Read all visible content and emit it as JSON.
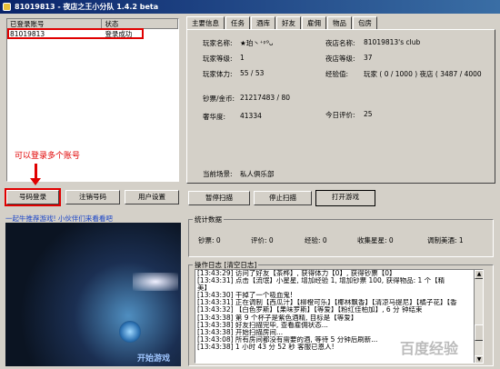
{
  "window": {
    "title": "81019813 - 夜店之王小分队 1.4.2 beta"
  },
  "accounts": {
    "col_account": "已登录账号",
    "col_status": "状态",
    "rows": [
      {
        "account": "81019813",
        "status": "登录成功"
      }
    ]
  },
  "annotation": "可以登录多个账号",
  "buttons": {
    "login": "号码登录",
    "logout": "注销号码",
    "settings": "用户设置",
    "pause_scan": "暂停扫描",
    "stop_scan": "停止扫描",
    "open_game": "打开游戏"
  },
  "promo": {
    "link": "一起牛推荐游戏! 小伙伴们来看看吧",
    "game_text": "开始游戏"
  },
  "tabs": [
    "主要信息",
    "任务",
    "酒库",
    "好友",
    "雇佣",
    "物品",
    "包房"
  ],
  "info": {
    "player_name_label": "玩家名称:",
    "player_name_value": "★珀丶⁺ᵖ⁹ᴗ",
    "club_name_label": "夜店名称:",
    "club_name_value": "81019813's club",
    "player_level_label": "玩家等级:",
    "player_level_value": "1",
    "club_level_label": "夜店等级:",
    "club_level_value": "37",
    "stamina_label": "玩家体力:",
    "stamina_value": "55 / 53",
    "exp_label": "经验值:",
    "exp_value": "玩家 ( 0 / 1000 )   夜店 ( 3487 / 4000",
    "money_label": "钞票/金币:",
    "money_value": "21217483 / 80",
    "luxury_label": "奢华度:",
    "luxury_value": "41334",
    "today_label": "今日评价:",
    "today_value": "25",
    "scene_label": "当前场景:",
    "scene_value": "私人俱乐部"
  },
  "stats": {
    "title": "统计数据",
    "money": "钞票: 0",
    "rating": "评价: 0",
    "exp": "经验: 0",
    "stars": "收集星星: 0",
    "mix": "调制美酒: 1"
  },
  "log": {
    "title": "操作日志",
    "clear": "清空日志",
    "lines": [
      "[13:43:29]  访问了好友【茶桦】, 获得体力【0】, 获得钞票【0】",
      "[13:43:31]  点击【流氓】小星星, 增加经验 1, 增加钞票 100, 获得物品: 1 个【精",
      "              美】",
      "[13:43:30]  干掉了一个吸血鬼!",
      "[13:43:31]  正在调制【西瓜汁】【柳橙可乐】【椰林飘香】【清凉马提尼】【橘子花】【香",
      "[13:43:32]  【白色罗斯】【果味罗斯】【等爱】【粉红佳柏加】, 6 分 钟结束",
      "[13:43:38]  第 9 个杯子是紫色酒精, 目标是【等爱】",
      "[13:43:38]  好友扫描完毕, 查看雇佣状态...",
      "[13:43:38]  开始扫描房间...",
      "[13:43:08]  所有房间都没有需要的酒, 等待 5 分钟后刷新...",
      "[13:43:38]  1 小时 43 分 52 秒  客服已恩人!"
    ]
  },
  "watermark": "百度经验"
}
